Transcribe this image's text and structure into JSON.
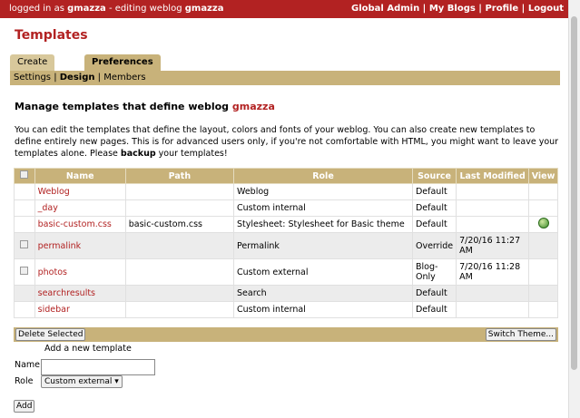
{
  "topbar": {
    "logged_prefix": "logged in as",
    "user": "gmazza",
    "editing_prefix": " - editing weblog",
    "weblog": "gmazza",
    "links": [
      "Global Admin",
      "My Blogs",
      "Profile",
      "Logout"
    ],
    "separator": " | "
  },
  "page": {
    "title": "Templates"
  },
  "tabs": [
    {
      "label": "Create & Edit",
      "active": false
    },
    {
      "label": "Preferences",
      "active": true
    }
  ],
  "subnav": {
    "items": [
      "Settings",
      "Design",
      "Members"
    ],
    "active": "Design"
  },
  "section": {
    "heading": "Manage templates that define weblog",
    "weblog": "gmazza",
    "desc_main": "You can edit the templates that define the layout, colors and fonts of your weblog. You can also create new templates to define entirely new pages. This is for advanced users only, if you're not comfortable with HTML, you might want to leave your templates alone. Please",
    "desc_bold": "backup",
    "desc_tail": "your templates!"
  },
  "table": {
    "columns": [
      "Name",
      "Path",
      "Role",
      "Source",
      "Last Modified",
      "View"
    ],
    "rows": [
      {
        "checkbox": false,
        "name": "Weblog",
        "path": "",
        "role": "Weblog",
        "source": "Default",
        "modified": "",
        "view": false
      },
      {
        "checkbox": false,
        "name": "_day",
        "path": "",
        "role": "Custom internal",
        "source": "Default",
        "modified": "",
        "view": false
      },
      {
        "checkbox": false,
        "name": "basic-custom.css",
        "path": "basic-custom.css",
        "role": "Stylesheet: Stylesheet for Basic theme",
        "source": "Default",
        "modified": "",
        "view": true
      },
      {
        "checkbox": true,
        "name": "permalink",
        "path": "",
        "role": "Permalink",
        "source": "Override",
        "modified": "7/20/16 11:27 AM",
        "view": false
      },
      {
        "checkbox": true,
        "name": "photos",
        "path": "",
        "role": "Custom external",
        "source": "Blog-Only",
        "modified": "7/20/16 11:28 AM",
        "view": false
      },
      {
        "checkbox": false,
        "name": "searchresults",
        "path": "",
        "role": "Search",
        "source": "Default",
        "modified": "",
        "view": false
      },
      {
        "checkbox": false,
        "name": "sidebar",
        "path": "",
        "role": "Custom internal",
        "source": "Default",
        "modified": "",
        "view": false
      }
    ]
  },
  "actions": {
    "delete": "Delete Selected",
    "switch": "Switch Theme..."
  },
  "add_form": {
    "title": "Add a new template",
    "name_label": "Name",
    "name_value": "",
    "role_label": "Role",
    "role_value": "Custom external",
    "add_button": "Add"
  },
  "colors": {
    "brand_red": "#b22222",
    "tan": "#c8b27a"
  },
  "icons": {
    "view": "view-globe-icon",
    "select_all": "checkbox-icon"
  }
}
